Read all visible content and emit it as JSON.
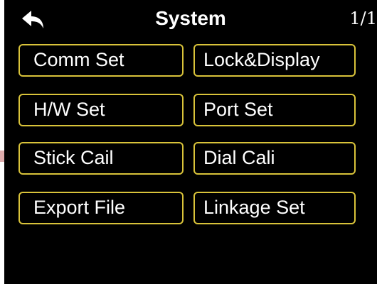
{
  "header": {
    "back_icon": "back-arrow-icon",
    "title": "System",
    "page": "1/1"
  },
  "menu": {
    "items": [
      {
        "label": "Comm Set"
      },
      {
        "label": "Lock&Display"
      },
      {
        "label": "H/W Set"
      },
      {
        "label": "Port Set"
      },
      {
        "label": "Stick Cail"
      },
      {
        "label": "Dial Cali"
      },
      {
        "label": "Export File"
      },
      {
        "label": "Linkage Set"
      }
    ]
  },
  "colors": {
    "background": "#000000",
    "text": "#ffffff",
    "button_border": "#d9c33a"
  }
}
